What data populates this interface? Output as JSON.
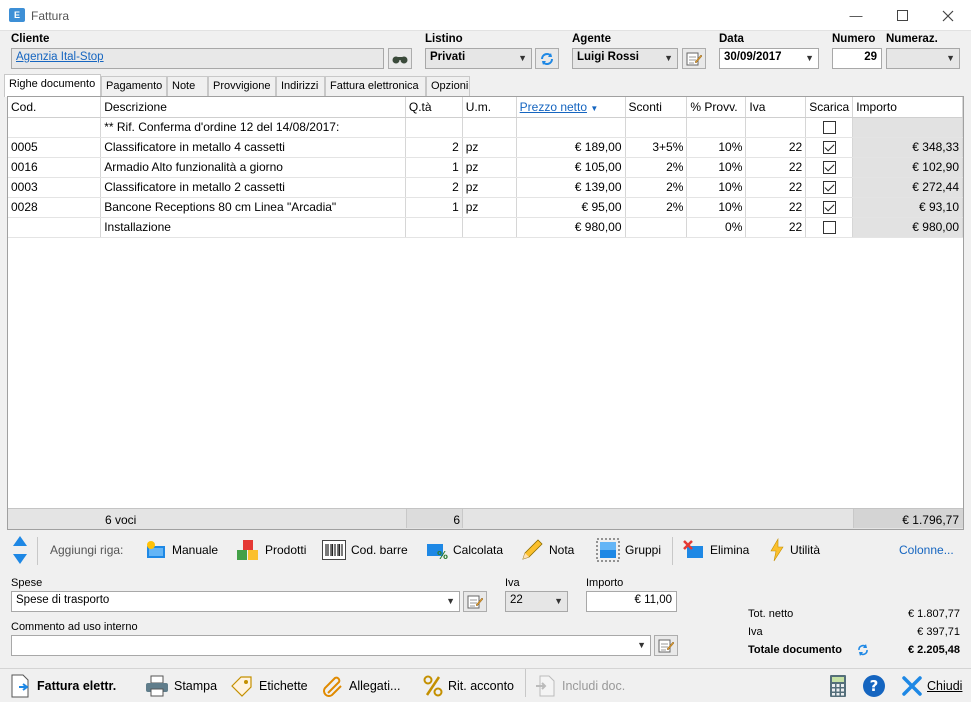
{
  "window": {
    "title": "Fattura",
    "icon_text": "E"
  },
  "header": {
    "cliente_label": "Cliente",
    "cliente_value": "Agenzia Ital-Stop",
    "listino_label": "Listino",
    "listino_value": "Privati",
    "agente_label": "Agente",
    "agente_value": "Luigi Rossi",
    "data_label": "Data",
    "data_value": "30/09/2017",
    "numero_label": "Numero",
    "numero_value": "29",
    "numeraz_label": "Numeraz.",
    "numeraz_value": ""
  },
  "tabs": [
    {
      "label": "Righe documento"
    },
    {
      "label": "Pagamento"
    },
    {
      "label": "Note"
    },
    {
      "label": "Provvigione"
    },
    {
      "label": "Indirizzi"
    },
    {
      "label": "Fattura elettronica"
    },
    {
      "label": "Opzioni"
    }
  ],
  "grid": {
    "columns": [
      "Cod.",
      "Descrizione",
      "Q.tà",
      "U.m.",
      "Prezzo netto",
      "Sconti",
      "% Provv.",
      "Iva",
      "Scarica",
      "Importo"
    ],
    "rows": [
      {
        "cod": "",
        "desc": "** Rif. Conferma d'ordine 12 del 14/08/2017:",
        "qta": "",
        "um": "",
        "prezzo": "",
        "sconti": "",
        "provv": "",
        "iva": "",
        "scarica": false,
        "importo": ""
      },
      {
        "cod": "0005",
        "desc": "Classificatore in metallo 4 cassetti",
        "qta": "2",
        "um": "pz",
        "prezzo": "€ 189,00",
        "sconti": "3+5%",
        "provv": "10%",
        "iva": "22",
        "scarica": true,
        "importo": "€ 348,33"
      },
      {
        "cod": "0016",
        "desc": "Armadio Alto funzionalità a giorno",
        "qta": "1",
        "um": "pz",
        "prezzo": "€ 105,00",
        "sconti": "2%",
        "provv": "10%",
        "iva": "22",
        "scarica": true,
        "importo": "€ 102,90"
      },
      {
        "cod": "0003",
        "desc": "Classificatore in metallo 2 cassetti",
        "qta": "2",
        "um": "pz",
        "prezzo": "€ 139,00",
        "sconti": "2%",
        "provv": "10%",
        "iva": "22",
        "scarica": true,
        "importo": "€ 272,44"
      },
      {
        "cod": "0028",
        "desc": "Bancone Receptions 80 cm Linea \"Arcadia\"",
        "qta": "1",
        "um": "pz",
        "prezzo": "€ 95,00",
        "sconti": "2%",
        "provv": "10%",
        "iva": "22",
        "scarica": true,
        "importo": "€ 93,10"
      },
      {
        "cod": "",
        "desc": "Installazione",
        "qta": "",
        "um": "",
        "prezzo": "€ 980,00",
        "sconti": "",
        "provv": "0%",
        "iva": "22",
        "scarica": false,
        "importo": "€ 980,00"
      }
    ],
    "footer": {
      "voci": "6 voci",
      "qta_total": "6",
      "importo_total": "€ 1.796,77"
    }
  },
  "toolbar": {
    "aggiungi_label": "Aggiungi riga:",
    "manuale": "Manuale",
    "prodotti": "Prodotti",
    "cod_barre": "Cod. barre",
    "calcolata": "Calcolata",
    "nota": "Nota",
    "gruppi": "Gruppi",
    "elimina": "Elimina",
    "utilita": "Utilità",
    "colonne": "Colonne..."
  },
  "spese": {
    "label": "Spese",
    "value": "Spese di trasporto",
    "iva_label": "Iva",
    "iva_value": "22",
    "importo_label": "Importo",
    "importo_value": "€ 11,00"
  },
  "commento": {
    "label": "Commento ad uso interno",
    "value": ""
  },
  "totals": {
    "netto_label": "Tot. netto",
    "netto_value": "€ 1.807,77",
    "iva_label": "Iva",
    "iva_value": "€ 397,71",
    "documento_label": "Totale documento",
    "documento_value": "€ 2.205,48"
  },
  "bottom": {
    "fattura_elettr": "Fattura elettr.",
    "stampa": "Stampa",
    "etichette": "Etichette",
    "allegati": "Allegati...",
    "rit_acconto": "Rit. acconto",
    "includi_doc": "Includi doc.",
    "chiudi": "Chiudi"
  },
  "colors": {
    "accent": "#1565c0",
    "total_cell": "#e2e2e2",
    "window_bg": "#f0f0f0"
  }
}
